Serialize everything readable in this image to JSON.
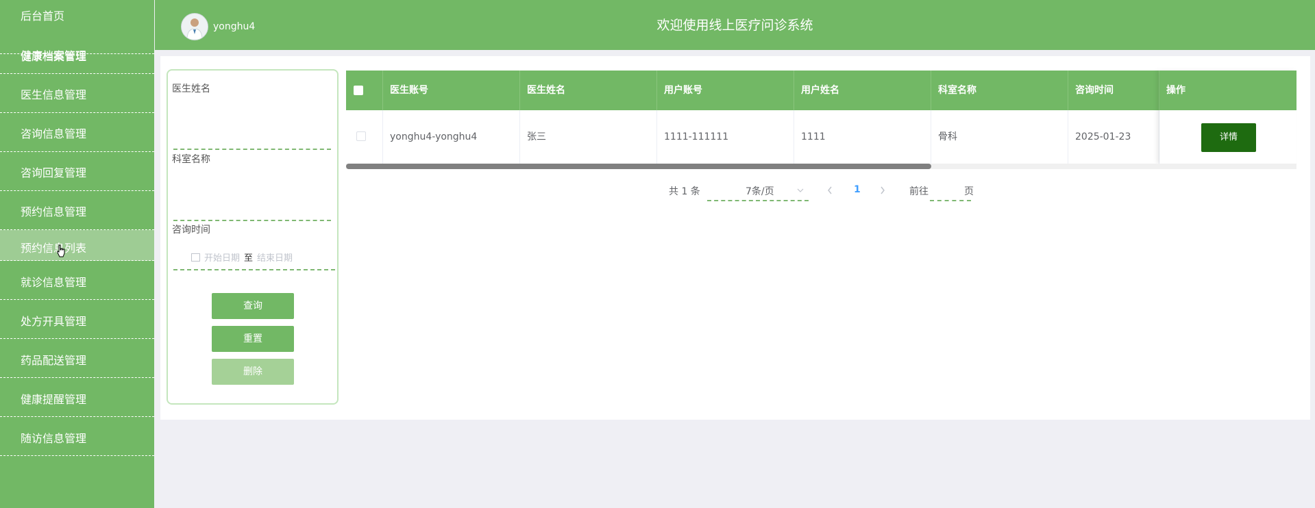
{
  "sidebar": {
    "home": "后台首页",
    "items": [
      {
        "label": "健康档案管理"
      },
      {
        "label": "医生信息管理"
      },
      {
        "label": "咨询信息管理"
      },
      {
        "label": "咨询回复管理"
      },
      {
        "label": "预约信息管理"
      },
      {
        "label": "预约信息列表",
        "active": true
      },
      {
        "label": "就诊信息管理"
      },
      {
        "label": "处方开具管理"
      },
      {
        "label": "药品配送管理"
      },
      {
        "label": "健康提醒管理"
      },
      {
        "label": "随访信息管理"
      }
    ]
  },
  "header": {
    "username": "yonghu4",
    "title": "欢迎使用线上医疗问诊系统"
  },
  "search": {
    "doctor_name_label": "医生姓名",
    "dept_label": "科室名称",
    "time_label": "咨询时间",
    "start_placeholder": "开始日期",
    "range_sep": "至",
    "end_placeholder": "结束日期",
    "query_btn": "查询",
    "reset_btn": "重置",
    "delete_btn": "删除"
  },
  "table": {
    "headers": [
      "医生账号",
      "医生姓名",
      "用户账号",
      "用户姓名",
      "科室名称",
      "咨询时间",
      "操作"
    ],
    "rows": [
      {
        "doctor_account": "yonghu4-yonghu4",
        "doctor_name": "张三",
        "user_account": "1111-111111",
        "user_name": "1111",
        "dept": "骨科",
        "time": "2025-01-23",
        "action": "详情"
      }
    ]
  },
  "pagination": {
    "total": "共 1 条",
    "page_size": "7条/页",
    "current_page": "1",
    "goto_prefix": "前往",
    "goto_suffix": "页"
  },
  "colors": {
    "primary": "#72b865",
    "active_item": "#9ecc94",
    "detail_button": "#1e6b10"
  }
}
